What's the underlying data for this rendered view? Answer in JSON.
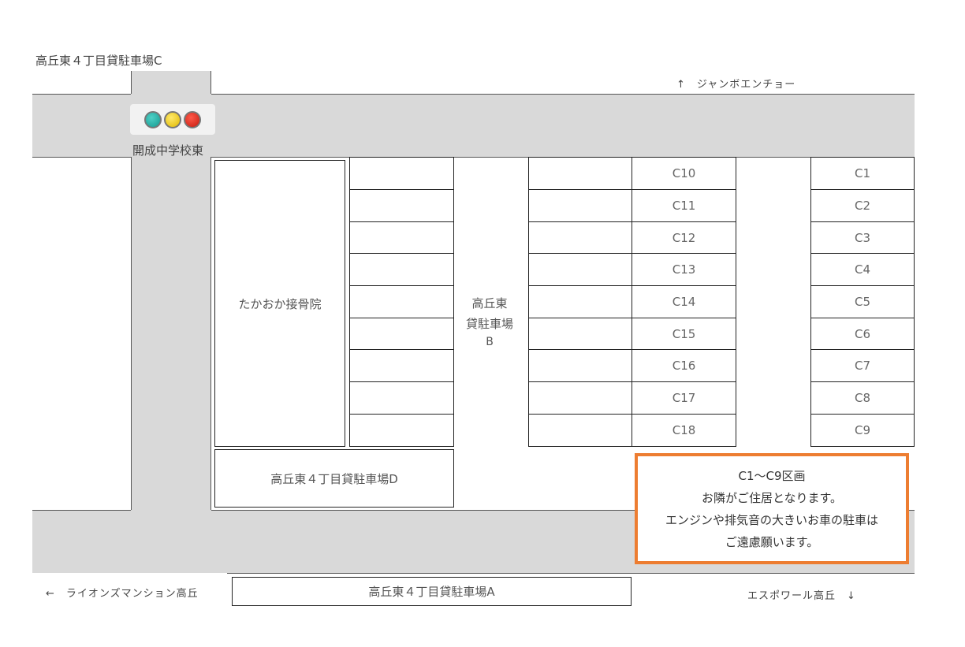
{
  "top_label": "高丘東４丁目貸駐車場C",
  "direction_top_right": "↑　ジャンボエンチョー",
  "signal": {
    "label": "開成中学校東",
    "lamps": [
      "green",
      "yellow",
      "red"
    ],
    "colors": {
      "green": "#1fb3a8",
      "yellow": "#f5d20c",
      "red": "#e3291c"
    }
  },
  "clinic": "たかおか接骨院",
  "lot_b": {
    "line1": "高丘東",
    "line2": "貸駐車場",
    "line3": "B"
  },
  "lot_d": "高丘東４丁目貸駐車場D",
  "lot_a": "高丘東４丁目貸駐車場A",
  "column_c_middle": [
    "C10",
    "C11",
    "C12",
    "C13",
    "C14",
    "C15",
    "C16",
    "C17",
    "C18"
  ],
  "column_c_right": [
    "C1",
    "C2",
    "C3",
    "C4",
    "C5",
    "C6",
    "C7",
    "C8",
    "C9"
  ],
  "notice": {
    "line1": "C1〜C9区画",
    "line2": "お隣がご住居となります。",
    "line3": "エンジンや排気音の大きいお車の駐車は",
    "line4": "ご遠慮願います。",
    "border_color": "#ed7d31"
  },
  "direction_bottom_left": "←　ライオンズマンション高丘",
  "direction_bottom_right": "エスポワール高丘　↓",
  "road_color": "#d9d9d9"
}
